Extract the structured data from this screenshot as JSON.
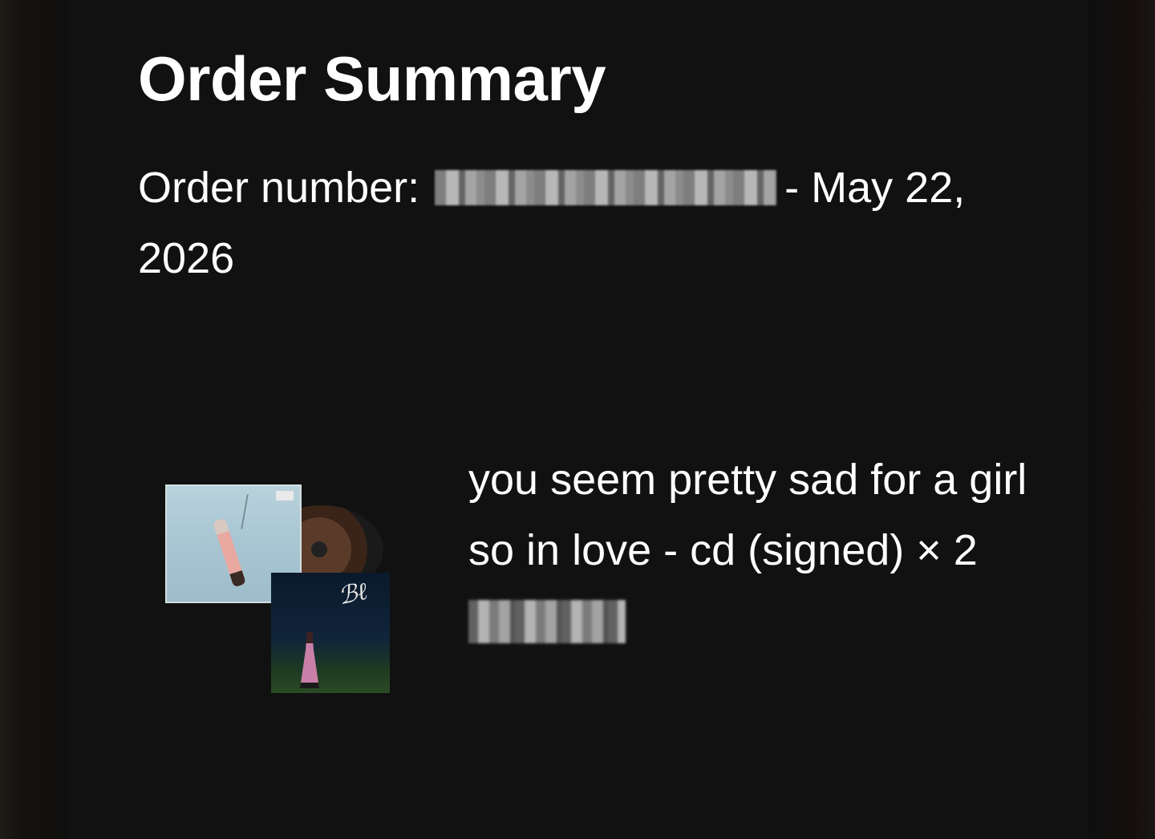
{
  "summary": {
    "title": "Order Summary",
    "order_label": "Order number:",
    "order_number": "",
    "date_text": "- May 22, 2026"
  },
  "item": {
    "name": "you seem pretty sad for a girl so in love - cd (signed)",
    "quantity_text": "× 2",
    "price": "",
    "image_alt": "album cd and signed art card"
  },
  "colors": {
    "background": "#111111",
    "text": "#ffffff"
  }
}
